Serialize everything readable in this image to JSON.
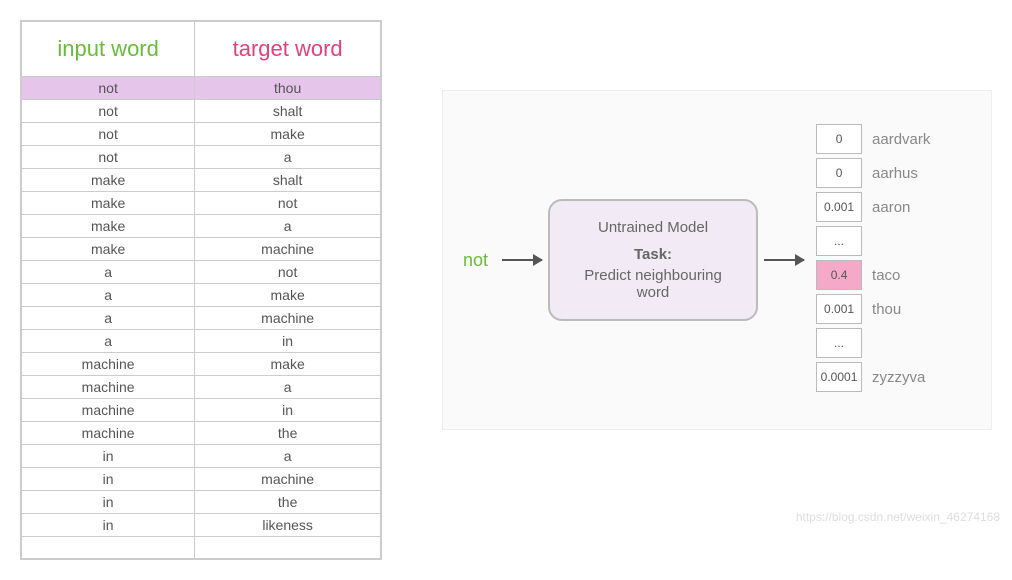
{
  "table": {
    "headers": {
      "input": "input word",
      "target": "target word"
    },
    "rows": [
      {
        "i": "not",
        "t": "thou",
        "hl": true
      },
      {
        "i": "not",
        "t": "shalt"
      },
      {
        "i": "not",
        "t": "make"
      },
      {
        "i": "not",
        "t": "a"
      },
      {
        "i": "make",
        "t": "shalt"
      },
      {
        "i": "make",
        "t": "not"
      },
      {
        "i": "make",
        "t": "a"
      },
      {
        "i": "make",
        "t": "machine"
      },
      {
        "i": "a",
        "t": "not"
      },
      {
        "i": "a",
        "t": "make"
      },
      {
        "i": "a",
        "t": "machine"
      },
      {
        "i": "a",
        "t": "in"
      },
      {
        "i": "machine",
        "t": "make"
      },
      {
        "i": "machine",
        "t": "a"
      },
      {
        "i": "machine",
        "t": "in"
      },
      {
        "i": "machine",
        "t": "the"
      },
      {
        "i": "in",
        "t": "a"
      },
      {
        "i": "in",
        "t": "machine"
      },
      {
        "i": "in",
        "t": "the"
      },
      {
        "i": "in",
        "t": "likeness"
      }
    ]
  },
  "diagram": {
    "input_word": "not",
    "model": {
      "title": "Untrained Model",
      "task_label": "Task:",
      "task_desc": "Predict neighbouring word"
    },
    "outputs": [
      {
        "prob": "0",
        "word": "aardvark"
      },
      {
        "prob": "0",
        "word": "aarhus"
      },
      {
        "prob": "0.001",
        "word": "aaron"
      },
      {
        "prob": "...",
        "word": ""
      },
      {
        "prob": "0.4",
        "word": "taco",
        "hl": true
      },
      {
        "prob": "0.001",
        "word": "thou"
      },
      {
        "prob": "...",
        "word": ""
      },
      {
        "prob": "0.0001",
        "word": "zyzzyva"
      }
    ]
  },
  "watermark": "https://blog.csdn.net/weixin_46274168"
}
